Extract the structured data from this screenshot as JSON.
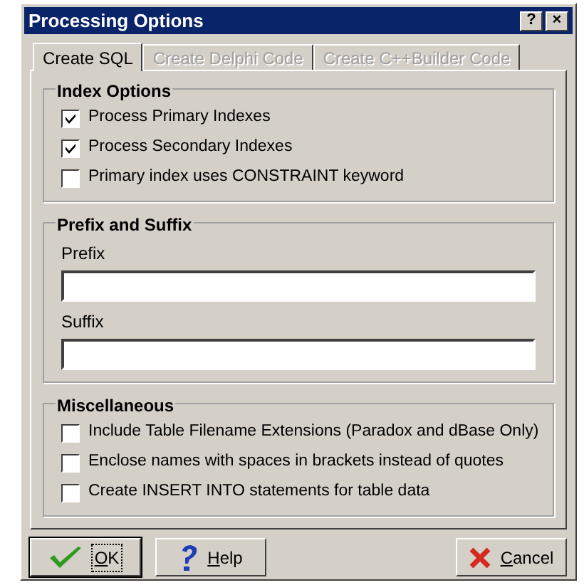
{
  "window": {
    "title": "Processing Options",
    "title_buttons": [
      "?",
      "×"
    ]
  },
  "tabs": [
    {
      "label": "Create SQL",
      "selected": true,
      "disabled": false
    },
    {
      "label": "Create Delphi Code",
      "selected": false,
      "disabled": true
    },
    {
      "label": "Create C++Builder Code",
      "selected": false,
      "disabled": true
    }
  ],
  "groups": [
    {
      "title": "Index Options",
      "items": [
        {
          "kind": "checkbox",
          "label": "Process Primary Indexes",
          "checked": true
        },
        {
          "kind": "checkbox",
          "label": "Process Secondary Indexes",
          "checked": true
        },
        {
          "kind": "checkbox",
          "label": "Primary index uses CONSTRAINT keyword",
          "checked": false
        }
      ]
    },
    {
      "title": "Prefix and Suffix",
      "items": [
        {
          "kind": "field",
          "label": "Prefix"
        },
        {
          "kind": "field",
          "label": "Suffix"
        }
      ]
    },
    {
      "title": "Miscellaneous",
      "items": [
        {
          "kind": "checkbox",
          "label": "Include Table Filename Extensions (Paradox and dBase Only)",
          "checked": false
        },
        {
          "kind": "checkbox",
          "label": "Enclose names with spaces in brackets instead of quotes",
          "checked": false
        },
        {
          "kind": "checkbox",
          "label": "Create INSERT INTO statements for table data",
          "checked": false
        }
      ]
    }
  ],
  "buttons": [
    {
      "kind": "ok",
      "accel": "O",
      "rest": "K",
      "focused": true
    },
    {
      "kind": "help",
      "accel": "H",
      "rest": "elp",
      "focused": false
    },
    {
      "kind": "cancel",
      "accel": "C",
      "rest": "ancel",
      "focused": false
    }
  ]
}
